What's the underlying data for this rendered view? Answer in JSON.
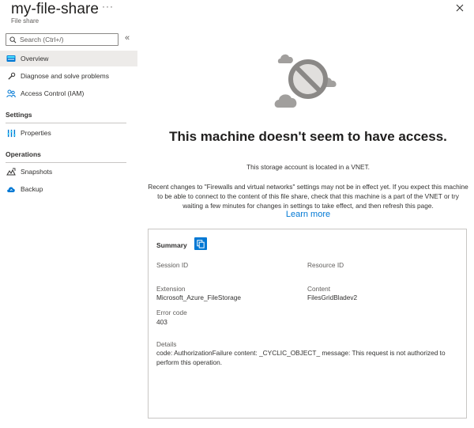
{
  "header": {
    "title": "my-file-share",
    "ellipsis": "···",
    "subtitle": "File share"
  },
  "sidebar": {
    "search_placeholder": "Search (Ctrl+/)",
    "collapse": "«",
    "items": [
      {
        "label": "Overview",
        "icon": "file-share-icon",
        "active": true
      },
      {
        "label": "Diagnose and solve problems",
        "icon": "wrench-icon"
      },
      {
        "label": "Access Control (IAM)",
        "icon": "people-icon"
      }
    ],
    "sections": [
      {
        "title": "Settings",
        "items": [
          {
            "label": "Properties",
            "icon": "properties-icon"
          }
        ]
      },
      {
        "title": "Operations",
        "items": [
          {
            "label": "Snapshots",
            "icon": "snapshots-icon"
          },
          {
            "label": "Backup",
            "icon": "cloud-backup-icon"
          }
        ]
      }
    ]
  },
  "main": {
    "heading": "This machine doesn't seem to have access.",
    "vnet_text": "This storage account is located in a VNET.",
    "description": "Recent changes to \"Firewalls and virtual networks\" settings may not be in effect yet. If you expect this machine to be able to connect to the content of this file share, check that this machine is a part of the VNET or try waiting a few minutes for changes in settings to take effect, and then refresh this page.",
    "learn_more": "Learn more",
    "summary": {
      "title": "Summary",
      "session_id_label": "Session ID",
      "session_id_value": "",
      "resource_id_label": "Resource ID",
      "resource_id_value": "",
      "extension_label": "Extension",
      "extension_value": "Microsoft_Azure_FileStorage",
      "content_label": "Content",
      "content_value": "FilesGridBladev2",
      "error_code_label": "Error code",
      "error_code_value": "403",
      "details_label": "Details",
      "details_value": "code: AuthorizationFailure content: _CYCLIC_OBJECT_ message: This request is not authorized to perform this operation."
    }
  },
  "colors": {
    "accent": "#0078d4",
    "active_bg": "#edebe9",
    "border": "#c8c6c4"
  }
}
